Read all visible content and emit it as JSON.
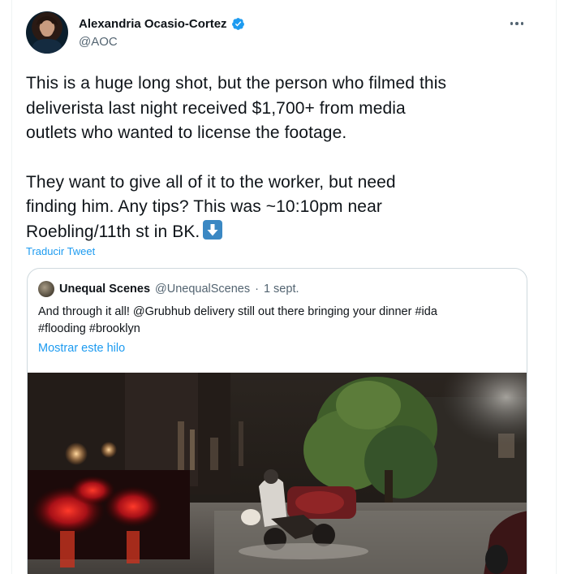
{
  "tweet": {
    "author": {
      "display_name": "Alexandria Ocasio-Cortez",
      "handle": "@AOC",
      "verified": true
    },
    "text_lines_p1": [
      "This is a huge long shot, but the person who filmed this",
      "deliverista last night received $1,700+ from media",
      "outlets who wanted to license the footage."
    ],
    "text_lines_p2": [
      "They want to give all of it to the worker, but need",
      "finding him. Any tips? This was ~10:10pm near",
      "Roebling/11th st in BK."
    ],
    "emoji": "down-arrow-emoji",
    "translate_label": "Traducir Tweet"
  },
  "quote": {
    "author_name": "Unequal Scenes",
    "author_handle": "@UnequalScenes",
    "separator": "·",
    "date": "1 sept.",
    "text_line1": "And through it all! @Grubhub delivery still out there bringing your dinner #ida",
    "text_line2": "#flooding #brooklyn",
    "show_thread_label": "Mostrar este hilo"
  },
  "colors": {
    "link": "#1d9bf0",
    "verified": "#1d9bf0",
    "secondary_text": "#536471",
    "border": "#cfd9de"
  },
  "icons": {
    "verified": "verified-badge-icon",
    "more": "more-horizontal-icon",
    "emoji": "down-arrow-emoji-icon"
  }
}
